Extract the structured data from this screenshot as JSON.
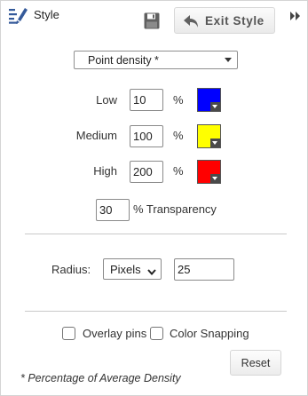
{
  "header": {
    "title": "Style",
    "exit_button_label": "Exit Style"
  },
  "density": {
    "selected": "Point density *"
  },
  "levels": [
    {
      "label": "Low",
      "value": "10",
      "unit": "%",
      "color": "#0000ff"
    },
    {
      "label": "Medium",
      "value": "100",
      "unit": "%",
      "color": "#ffff00"
    },
    {
      "label": "High",
      "value": "200",
      "unit": "%",
      "color": "#ff0000"
    }
  ],
  "transparency": {
    "value": "30",
    "label": "% Transparency"
  },
  "radius": {
    "label": "Radius:",
    "unit_selected": "Pixels",
    "value": "25"
  },
  "options": {
    "overlay_pins_label": "Overlay pins",
    "overlay_pins_checked": false,
    "color_snapping_label": "Color Snapping",
    "color_snapping_checked": false
  },
  "reset_label": "Reset",
  "footnote": "* Percentage of Average Density"
}
